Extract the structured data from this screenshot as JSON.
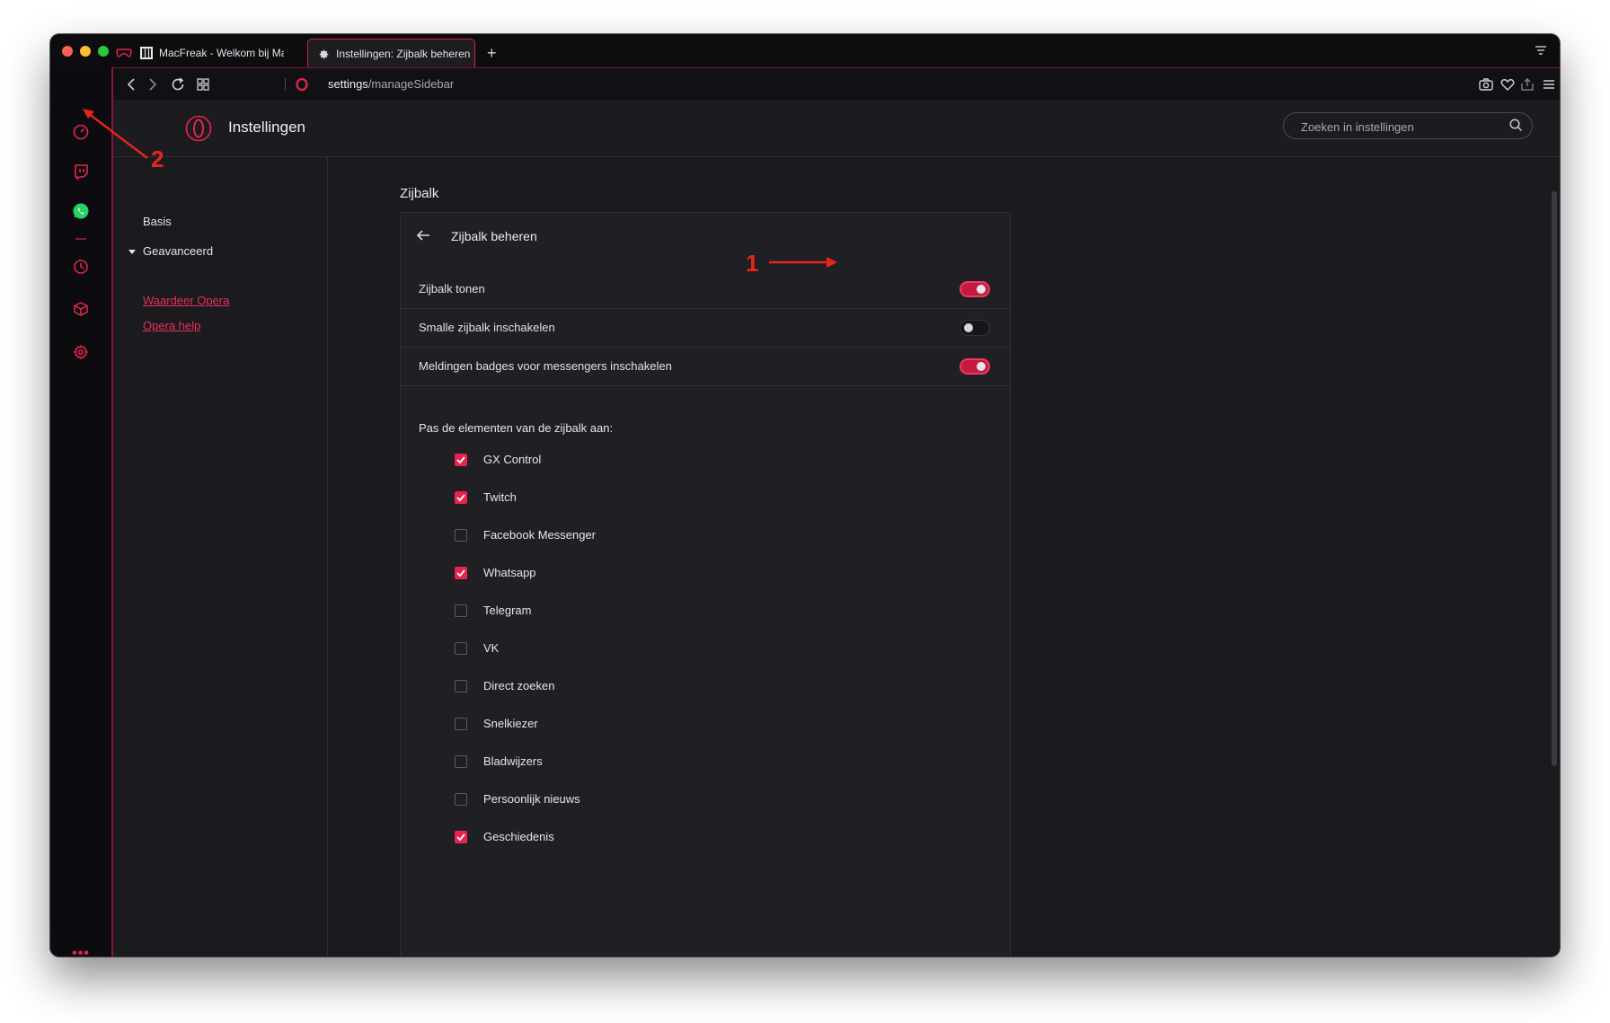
{
  "window": {
    "tabs": [
      {
        "label": "MacFreak - Welkom bij MacF",
        "active": false
      },
      {
        "label": "Instellingen: Zijbalk beheren",
        "active": true
      }
    ],
    "new_tab_symbol": "+"
  },
  "address": {
    "url_prefix": "settings",
    "url_path": "/manageSidebar"
  },
  "header": {
    "title": "Instellingen",
    "search_placeholder": "Zoeken in instellingen"
  },
  "leftnav": {
    "basic": "Basis",
    "advanced": "Geavanceerd",
    "links": [
      "Waardeer Opera",
      "Opera help"
    ]
  },
  "section": {
    "title": "Zijbalk",
    "card_title": "Zijbalk beheren",
    "toggles": [
      {
        "label": "Zijbalk tonen",
        "on": true
      },
      {
        "label": "Smalle zijbalk inschakelen",
        "on": false
      },
      {
        "label": "Meldingen badges voor messengers inschakelen",
        "on": true
      }
    ],
    "customize_title": "Pas de elementen van de zijbalk aan:",
    "items": [
      {
        "label": "GX Control",
        "checked": true
      },
      {
        "label": "Twitch",
        "checked": true
      },
      {
        "label": "Facebook Messenger",
        "checked": false
      },
      {
        "label": "Whatsapp",
        "checked": true
      },
      {
        "label": "Telegram",
        "checked": false
      },
      {
        "label": "VK",
        "checked": false
      },
      {
        "label": "Direct zoeken",
        "checked": false
      },
      {
        "label": "Snelkiezer",
        "checked": false
      },
      {
        "label": "Bladwijzers",
        "checked": false
      },
      {
        "label": "Persoonlijk nieuws",
        "checked": false
      },
      {
        "label": "Geschiedenis",
        "checked": true
      }
    ]
  },
  "annotations": {
    "label_1": "1",
    "label_2": "2",
    "color": "#e8251b"
  },
  "sidebar_icons": [
    "gx-control-icon",
    "twitch-icon",
    "whatsapp-icon",
    "history-icon",
    "cube-icon",
    "settings-icon",
    "more-icon"
  ],
  "colors": {
    "accent": "#e8234d",
    "background": "#1b1b1f"
  }
}
